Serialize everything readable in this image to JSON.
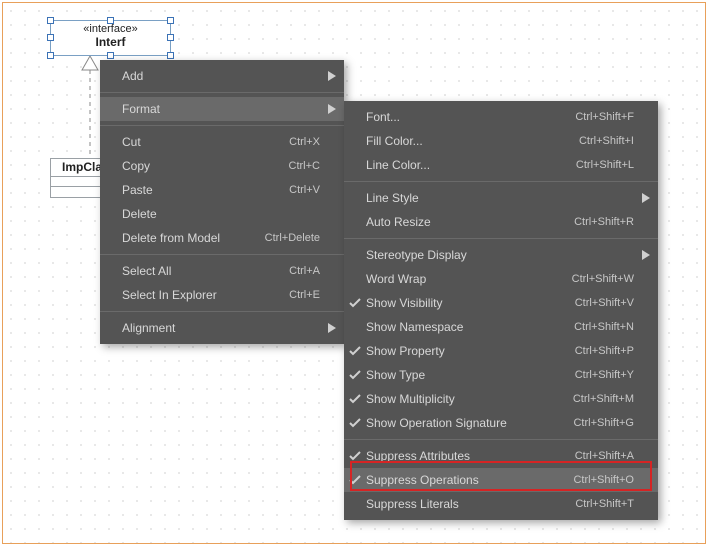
{
  "diagram": {
    "interface": {
      "stereo": "«interface»",
      "name": "Interf"
    },
    "impclass": {
      "name": "ImpCla"
    }
  },
  "menu_main": {
    "items": [
      {
        "label": "Add",
        "hotkey": "",
        "arrow": true
      },
      {
        "label": "Format",
        "hotkey": "",
        "arrow": true,
        "hover": true
      }
    ],
    "edit": [
      {
        "label": "Cut",
        "hotkey": "Ctrl+X"
      },
      {
        "label": "Copy",
        "hotkey": "Ctrl+C"
      },
      {
        "label": "Paste",
        "hotkey": "Ctrl+V"
      },
      {
        "label": "Delete",
        "hotkey": ""
      },
      {
        "label": "Delete from Model",
        "hotkey": "Ctrl+Delete"
      }
    ],
    "select": [
      {
        "label": "Select All",
        "hotkey": "Ctrl+A"
      },
      {
        "label": "Select In Explorer",
        "hotkey": "Ctrl+E"
      }
    ],
    "align": [
      {
        "label": "Alignment",
        "hotkey": "",
        "arrow": true
      }
    ]
  },
  "menu_format": {
    "group1": [
      {
        "label": "Font...",
        "hotkey": "Ctrl+Shift+F"
      },
      {
        "label": "Fill Color...",
        "hotkey": "Ctrl+Shift+I"
      },
      {
        "label": "Line Color...",
        "hotkey": "Ctrl+Shift+L"
      }
    ],
    "group2": [
      {
        "label": "Line Style",
        "hotkey": "",
        "arrow": true
      },
      {
        "label": "Auto Resize",
        "hotkey": "Ctrl+Shift+R"
      }
    ],
    "group3": [
      {
        "label": "Stereotype Display",
        "hotkey": "",
        "arrow": true
      },
      {
        "label": "Word Wrap",
        "hotkey": "Ctrl+Shift+W"
      },
      {
        "label": "Show Visibility",
        "hotkey": "Ctrl+Shift+V",
        "checked": true
      },
      {
        "label": "Show Namespace",
        "hotkey": "Ctrl+Shift+N"
      },
      {
        "label": "Show Property",
        "hotkey": "Ctrl+Shift+P",
        "checked": true
      },
      {
        "label": "Show Type",
        "hotkey": "Ctrl+Shift+Y",
        "checked": true
      },
      {
        "label": "Show Multiplicity",
        "hotkey": "Ctrl+Shift+M",
        "checked": true
      },
      {
        "label": "Show Operation Signature",
        "hotkey": "Ctrl+Shift+G",
        "checked": true
      }
    ],
    "group4": [
      {
        "label": "Suppress Attributes",
        "hotkey": "Ctrl+Shift+A",
        "checked": true
      },
      {
        "label": "Suppress Operations",
        "hotkey": "Ctrl+Shift+O",
        "checked": true,
        "hover": true
      },
      {
        "label": "Suppress Literals",
        "hotkey": "Ctrl+Shift+T"
      }
    ]
  }
}
